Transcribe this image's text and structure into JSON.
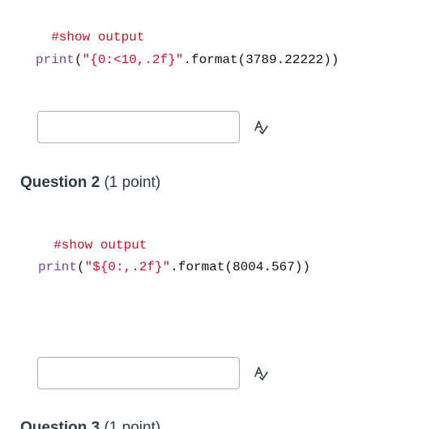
{
  "question1": {
    "comment": "#show output",
    "code": {
      "func": "print",
      "open": "(",
      "string": "\"{0:<10,.2f}\"",
      "method": ".format(",
      "number": "3789.22222",
      "close": "))"
    },
    "answer_value": "",
    "spell_icon": "spellcheck-icon"
  },
  "question2": {
    "title": "Question 2",
    "points": "(1 point)",
    "comment": "#show output",
    "code": {
      "func": "print",
      "open": "(",
      "string": "\"${0:,.2f}\"",
      "method": ".format(",
      "number": "8004.567",
      "close": "))"
    },
    "answer_value": "",
    "spell_icon": "spellcheck-icon"
  },
  "question3": {
    "title": "Question 3",
    "points": "(1 point)"
  }
}
